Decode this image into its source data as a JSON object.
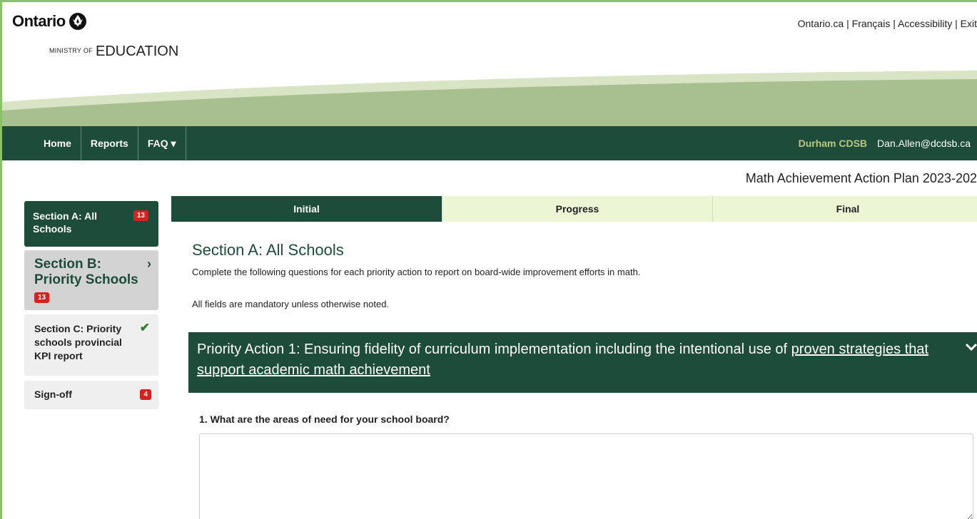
{
  "header": {
    "logo_text": "Ontario",
    "ministry_small": "MINISTRY OF",
    "ministry_big": "EDUCATION",
    "links": [
      {
        "label": "Ontario.ca"
      },
      {
        "label": "Français"
      },
      {
        "label": "Accessibility"
      },
      {
        "label": "Exit"
      }
    ]
  },
  "navbar": {
    "items": [
      {
        "label": "Home"
      },
      {
        "label": "Reports"
      },
      {
        "label": "FAQ ▾"
      }
    ],
    "board": "Durham CDSB",
    "user_email": "Dan.Allen@dcdsb.ca"
  },
  "plan_title": "Math Achievement Action Plan 2023-202",
  "sidebar": {
    "items": [
      {
        "label": "Section A: All Schools",
        "badge": "13"
      },
      {
        "label": "Section B: Priority Schools",
        "badge": "13",
        "chevron": "›"
      },
      {
        "label": "Section C: Priority schools provincial KPI report",
        "check": "✔"
      },
      {
        "label": "Sign-off",
        "badge": "4"
      }
    ]
  },
  "tabs": [
    {
      "label": "Initial",
      "active": true
    },
    {
      "label": "Progress",
      "active": false
    },
    {
      "label": "Final",
      "active": false
    }
  ],
  "main": {
    "section_title": "Section A: All Schools",
    "description": "Complete the following questions for each priority action to report on board-wide improvement efforts in math.",
    "note": "All fields are mandatory unless otherwise noted.",
    "priority_action": {
      "prefix": "Priority Action 1: Ensuring fidelity of curriculum implementation including the intentional use of ",
      "link_text": "proven strategies that support academic math achievement"
    },
    "question_1": "1. What are the areas of need for your school board?",
    "answer_1": ""
  },
  "colors": {
    "primary_green": "#1d4d3a",
    "light_green_tab": "#ecf5d4",
    "badge_red": "#d9201f",
    "board_text": "#b9c77e"
  },
  "icons": [
    "trillium-logo-icon",
    "chevron-right-icon",
    "check-icon",
    "chevron-down-icon",
    "caret-down-icon"
  ]
}
